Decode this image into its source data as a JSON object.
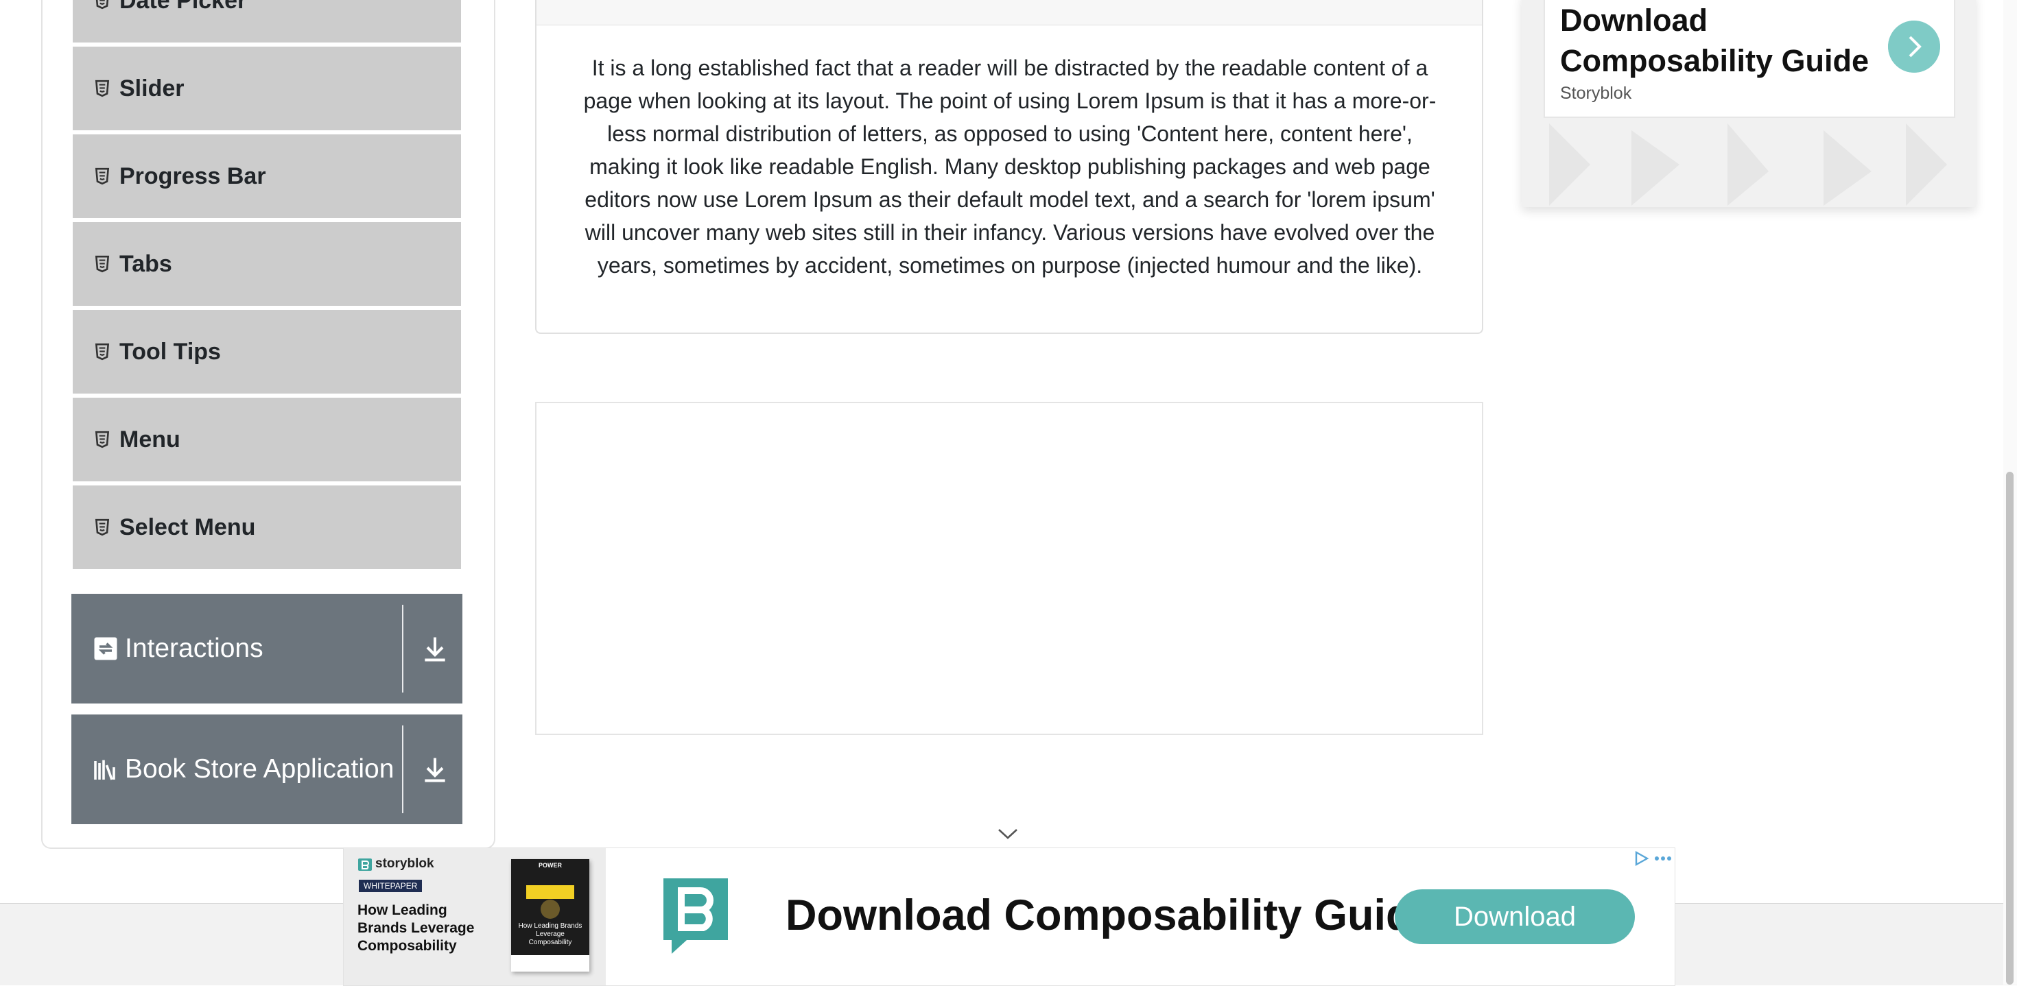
{
  "sidebar": {
    "items": [
      {
        "label": "Date Picker",
        "icon": "html5-icon"
      },
      {
        "label": "Slider",
        "icon": "html5-icon"
      },
      {
        "label": "Progress Bar",
        "icon": "html5-icon"
      },
      {
        "label": "Tabs",
        "icon": "html5-icon"
      },
      {
        "label": "Tool Tips",
        "icon": "html5-icon"
      },
      {
        "label": "Menu",
        "icon": "html5-icon"
      },
      {
        "label": "Select Menu",
        "icon": "html5-icon"
      }
    ],
    "groups": [
      {
        "label": "Interactions",
        "icon": "interactions-icon",
        "action_icon": "download-icon"
      },
      {
        "label": "Book Store Application",
        "icon": "books-icon",
        "action_icon": "download-icon"
      }
    ]
  },
  "main": {
    "paragraph": "It is a long established fact that a reader will be distracted by the readable content of a page when looking at its layout. The point of using Lorem Ipsum is that it has a more-or-less normal distribution of letters, as opposed to using 'Content here, content here', making it look like readable English. Many desktop publishing packages and web page editors now use Lorem Ipsum as their default model text, and a search for 'lorem ipsum' will uncover many web sites still in their infancy. Various versions have evolved over the years, sometimes by accident, sometimes on purpose (injected humour and the like)."
  },
  "side_ad": {
    "title": "Download Composability Guide",
    "brand": "Storyblok",
    "arrow_icon": "chevron-right-icon"
  },
  "banner_ad": {
    "brand": "storyblok",
    "tag": "WHITEPAPER",
    "headline": "How Leading Brands Leverage Composability",
    "book_title": "POWER",
    "book_text": "How Leading Brands Leverage Composability",
    "title": "Download Composability Guide",
    "button": "Download",
    "colors": {
      "accent": "#5bb7b2",
      "logo": "#3fa59f"
    }
  },
  "colors": {
    "menu_item_bg": "#cccccc",
    "group_bg": "#6c757d"
  }
}
